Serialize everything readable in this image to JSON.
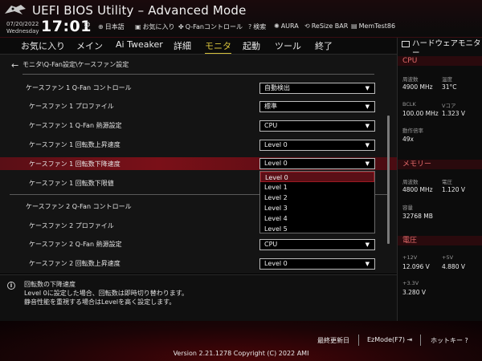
{
  "header": {
    "title": "UEFI BIOS Utility – Advanced Mode",
    "date": "07/20/2022",
    "weekday": "Wednesday",
    "time": "17:01",
    "tools": [
      {
        "label": "日本語",
        "icon": "globe-icon"
      },
      {
        "label": "お気に入り",
        "icon": "star-icon"
      },
      {
        "label": "Q-Fanコントロール",
        "icon": "fan-icon"
      },
      {
        "label": "検索",
        "icon": "search-help-icon"
      },
      {
        "label": "AURA",
        "icon": "aura-icon"
      },
      {
        "label": "ReSize BAR",
        "icon": "resize-bar-icon"
      },
      {
        "label": "MemTest86",
        "icon": "memtest-icon"
      }
    ]
  },
  "menu": {
    "items": [
      "お気に入り",
      "メイン",
      "Ai Tweaker",
      "詳細",
      "モニタ",
      "起動",
      "ツール",
      "終了"
    ],
    "active": "モニタ"
  },
  "breadcrumb": "モニタ\\Q-Fan設定\\ケースファン設定",
  "settings": [
    {
      "label": "ケースファン 1 Q-Fan コントロール",
      "value": "自動検出"
    },
    {
      "label": "ケースファン 1 プロファイル",
      "value": "標準"
    },
    {
      "label": "ケースファン 1 Q-Fan 熱源設定",
      "value": "CPU"
    },
    {
      "label": "ケースファン 1 回転数上昇速度",
      "value": "Level 0"
    },
    {
      "label": "ケースファン 1 回転数下降速度",
      "value": "Level 0"
    },
    {
      "label": "ケースファン 1 回転数下限値",
      "value": ""
    },
    {
      "label": "ケースファン 2 Q-Fan コントロール",
      "value": ""
    },
    {
      "label": "ケースファン 2 プロファイル",
      "value": ""
    },
    {
      "label": "ケースファン 2 Q-Fan 熱源設定",
      "value": "CPU"
    },
    {
      "label": "ケースファン 2 回転数上昇速度",
      "value": "Level 0"
    }
  ],
  "dropdown": {
    "options": [
      "Level 0",
      "Level 1",
      "Level 2",
      "Level 3",
      "Level 4",
      "Level 5"
    ],
    "selected": "Level 0"
  },
  "help": {
    "title": "回転数の下降速度",
    "line1": "Level 0に設定した場合、回転数は即時切り替わります。",
    "line2": "静音性能を重視する場合はLevelを高く設定します。"
  },
  "hwmon": {
    "title": "ハードウェアモニター",
    "cpu": {
      "section": "CPU",
      "freq_label": "周波数",
      "freq": "4900 MHz",
      "temp_label": "温度",
      "temp": "31°C",
      "bclk_label": "BCLK",
      "bclk": "100.00 MHz",
      "vcore_label": "Vコア",
      "vcore": "1.323 V",
      "ratio_label": "動作倍率",
      "ratio": "49x"
    },
    "memory": {
      "section": "メモリー",
      "freq_label": "周波数",
      "freq": "4800 MHz",
      "volt_label": "電圧",
      "volt": "1.120 V",
      "cap_label": "容量",
      "cap": "32768 MB"
    },
    "voltage": {
      "section": "電圧",
      "v12_label": "+12V",
      "v12": "12.096 V",
      "v5_label": "+5V",
      "v5": "4.880 V",
      "v33_label": "+3.3V",
      "v33": "3.280 V"
    }
  },
  "footer": {
    "last_modified": "最終更新日",
    "ezmode": "EzMode(F7)",
    "hotkeys": "ホットキー",
    "version": "Version 2.21.1278 Copyright (C) 2022 AMI"
  },
  "colors": {
    "accent": "#d7c23c",
    "highlight": "#7a1018",
    "section": "#e46a6a"
  }
}
